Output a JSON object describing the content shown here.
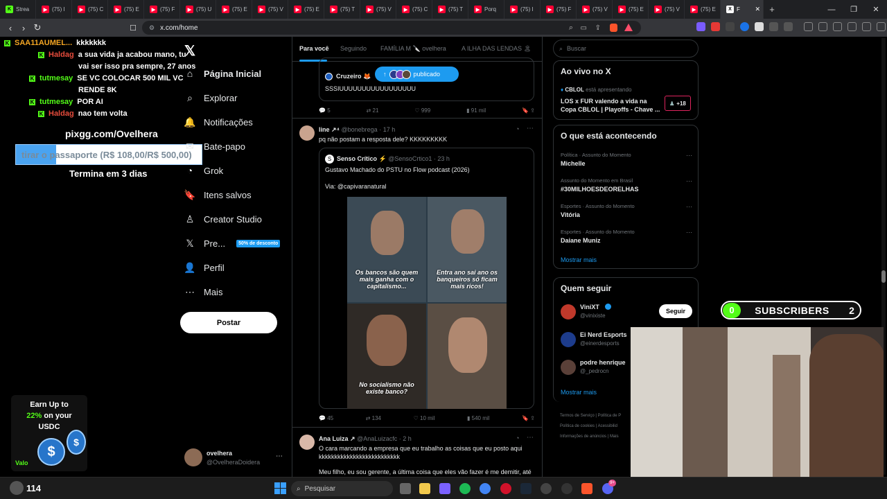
{
  "browser": {
    "tabs": [
      {
        "label": "Strea",
        "favicon": "kick"
      },
      {
        "label": "(75) I",
        "favicon": "youtube"
      },
      {
        "label": "(75) C",
        "favicon": "youtube"
      },
      {
        "label": "(75) E",
        "favicon": "youtube"
      },
      {
        "label": "(75) F",
        "favicon": "youtube"
      },
      {
        "label": "(75) U",
        "favicon": "youtube"
      },
      {
        "label": "(75) E",
        "favicon": "youtube"
      },
      {
        "label": "(75) V",
        "favicon": "youtube"
      },
      {
        "label": "(75) E",
        "favicon": "youtube"
      },
      {
        "label": "(75) T",
        "favicon": "youtube"
      },
      {
        "label": "(75) V",
        "favicon": "youtube"
      },
      {
        "label": "(75) C",
        "favicon": "youtube"
      },
      {
        "label": "(75) T",
        "favicon": "youtube"
      },
      {
        "label": "Porq",
        "favicon": "youtube"
      },
      {
        "label": "(75) I",
        "favicon": "youtube"
      },
      {
        "label": "(75) F",
        "favicon": "youtube"
      },
      {
        "label": "(75) V",
        "favicon": "youtube"
      },
      {
        "label": "(75) E",
        "favicon": "youtube"
      },
      {
        "label": "(75) V",
        "favicon": "youtube"
      },
      {
        "label": "(75) E",
        "favicon": "youtube"
      },
      {
        "label": "F",
        "favicon": "x",
        "active": true
      }
    ],
    "new_tab": "+",
    "url": "x.com/home"
  },
  "chat": {
    "messages": [
      {
        "user": "SAA11AUMEL...",
        "user_color": "#f5a623",
        "text": "kkkkkkk"
      },
      {
        "user": "Haldag",
        "user_color": "#e74c3c",
        "text": "a sua vida ja acabou mano, tu"
      },
      {
        "user": "",
        "user_color": "#fff",
        "text": "vai ser isso pra sempre, 27 anos"
      },
      {
        "user": "tutmesay",
        "user_color": "#53fc18",
        "text": "SE VC COLOCAR 500 MIL VC"
      },
      {
        "user": "",
        "user_color": "#fff",
        "text": "RENDE 8K"
      },
      {
        "user": "tutmesay",
        "user_color": "#53fc18",
        "text": "POR AI"
      },
      {
        "user": "Haldag",
        "user_color": "#e74c3c",
        "text": "nao tem volta"
      }
    ],
    "pix_url": "pixgg.com/Ovelhera",
    "goal_text": "tirar o passaporte (R$ 108,00/R$ 500,00)",
    "goal_progress": 0.216,
    "goal_ends": "Termina em 3 dias"
  },
  "ad": {
    "line1": "Earn Up to",
    "highlight": "22%",
    "line2": "on your",
    "line3": "USDC",
    "brand": "Valo"
  },
  "nav": {
    "items": [
      {
        "label": "Página Inicial",
        "icon": "home-icon",
        "glyph": "⌂",
        "bold": true
      },
      {
        "label": "Explorar",
        "icon": "search-icon",
        "glyph": "⌕"
      },
      {
        "label": "Notificações",
        "icon": "bell-icon",
        "glyph": "🔔"
      },
      {
        "label": "Bate-papo",
        "icon": "chat-icon",
        "glyph": "✉"
      },
      {
        "label": "Grok",
        "icon": "grok-icon",
        "glyph": "◔"
      },
      {
        "label": "Itens salvos",
        "icon": "bookmark-icon",
        "glyph": "🔖"
      },
      {
        "label": "Creator Studio",
        "icon": "creator-icon",
        "glyph": "♙"
      },
      {
        "label": "Pre...",
        "icon": "x-premium-icon",
        "glyph": "𝕏",
        "badge": "50% de desconto"
      },
      {
        "label": "Perfil",
        "icon": "profile-icon",
        "glyph": "👤"
      },
      {
        "label": "Mais",
        "icon": "more-icon",
        "glyph": "⋯"
      }
    ],
    "post_button": "Postar",
    "account": {
      "name": "ovelhera",
      "handle": "@OvelheraDoidera"
    }
  },
  "feed": {
    "tabs": [
      "Para você",
      "Seguindo",
      "FAMÍLIA M 🔪 ovelhera",
      "A ILHA DAS LENDAS 🏝"
    ],
    "published_pill": "publicado",
    "post1": {
      "quote_name": "Cruzeiro 🦊",
      "quote_text": "SSSIUUUUUUUUUUUUUUUUU",
      "replies": "5",
      "reposts": "21",
      "likes": "999",
      "views": "91 mil"
    },
    "post2": {
      "name": "line ↗⁴",
      "handle": "@bonebrega · 17 h",
      "text": "pq não postam a resposta dele? KKKKKKKKK",
      "quote_name": "Senso Crítico ⚡",
      "quote_handle": "@SensoCrtico1 · 23 h",
      "quote_text": "Gustavo Machado do PSTU no Flow podcast (2026)",
      "quote_via": "Via: @capivaranatural",
      "meme_captions": [
        "Os bancos são quem mais ganha com o capitalismo...",
        "Entra ano sai ano os banqueiros só ficam mais ricos!",
        "No socialismo não existe banco?"
      ],
      "replies": "45",
      "reposts": "134",
      "likes": "10 mil",
      "views": "540 mil"
    },
    "post3": {
      "name": "Ana Luiza ↗",
      "handle": "@AnaLuizacfc · 2 h",
      "text": "O cara marcando a empresa que eu trabalho as coisas que eu posto aqui kkkkkkkkkkkkkkkkkkkkkkkkkk",
      "text2": "Meu filho, eu sou gerente, a última coisa que eles vão fazer é me demitir, até"
    }
  },
  "right": {
    "search_placeholder": "Buscar",
    "live": {
      "title": "Ao vivo no X",
      "host": "CBLOL",
      "host_suffix": "está apresentando",
      "text": "LOS x FUR valendo a vida na Copa CBLOL | Playoffs - Chave ...",
      "extra": "+18"
    },
    "trends": {
      "title": "O que está acontecendo",
      "items": [
        {
          "meta": "Política · Assunto do Momento",
          "name": "Michelle"
        },
        {
          "meta": "Assunto do Momento em Brasil",
          "name": "#30MILHOESDEORELHAS"
        },
        {
          "meta": "Esportes · Assunto do Momento",
          "name": "Vitória"
        },
        {
          "meta": "Esportes · Assunto do Momento",
          "name": "Daiane Muniz"
        }
      ],
      "show_more": "Mostrar mais"
    },
    "follow": {
      "title": "Quem seguir",
      "items": [
        {
          "name": "ViniXT",
          "handle": "@vinixiste",
          "verified": true
        },
        {
          "name": "Ei Nerd Esports",
          "handle": "@einerdesports",
          "verified": true
        },
        {
          "name": "podre henrique",
          "handle": "@_pedrocn",
          "verified": false
        }
      ],
      "follow_label": "Seguir",
      "show_more": "Mostrar mais"
    },
    "footer": [
      "Termos de Serviço",
      "Política de P",
      "Política de cookies",
      "Acessibilid",
      "Informações de anúncios",
      "Mais"
    ]
  },
  "overlay": {
    "subs_left": "0",
    "subs_label": "SUBSCRIBERS",
    "subs_right": "2",
    "viewers": "114"
  },
  "taskbar": {
    "search_placeholder": "Pesquisar",
    "notif_count": "9+"
  }
}
